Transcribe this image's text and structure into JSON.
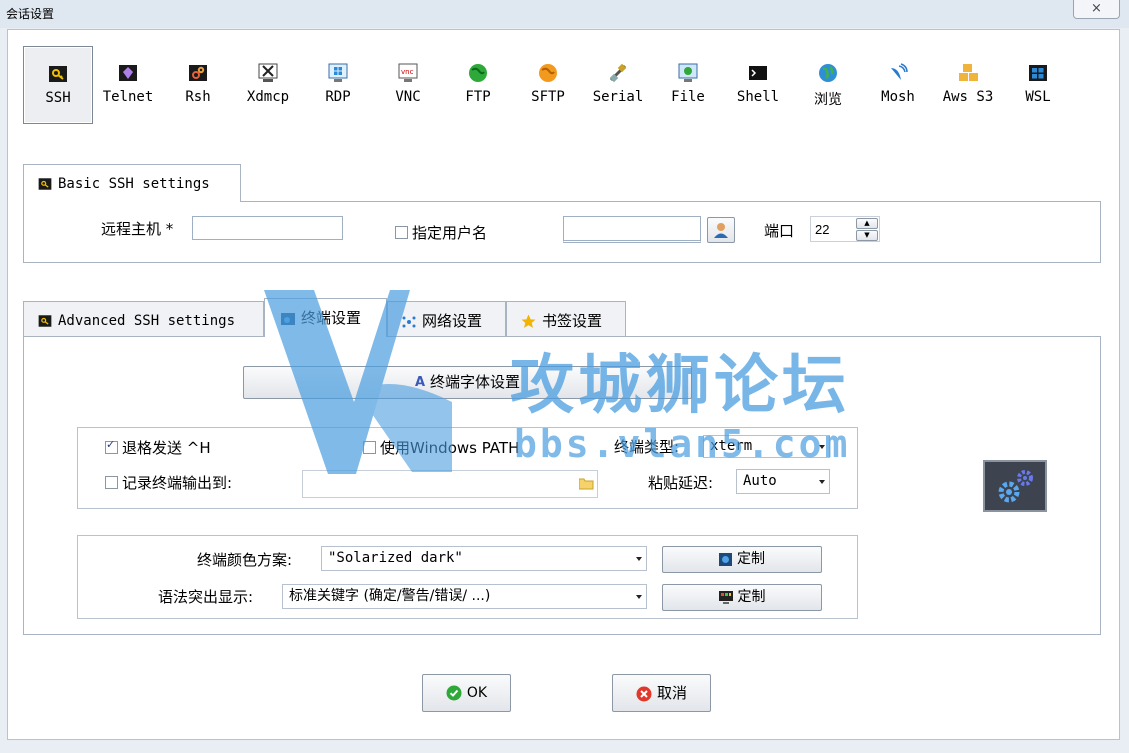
{
  "window": {
    "title": "会话设置",
    "close_glyph": "×"
  },
  "session_types": [
    {
      "label": "SSH",
      "icon": "key-icon",
      "selected": true
    },
    {
      "label": "Telnet",
      "icon": "purple-gem-icon"
    },
    {
      "label": "Rsh",
      "icon": "gears-icon"
    },
    {
      "label": "Xdmcp",
      "icon": "x-server-icon"
    },
    {
      "label": "RDP",
      "icon": "monitor-windows-icon"
    },
    {
      "label": "VNC",
      "icon": "vnc-icon"
    },
    {
      "label": "FTP",
      "icon": "globe-green-icon"
    },
    {
      "label": "SFTP",
      "icon": "globe-orange-icon"
    },
    {
      "label": "Serial",
      "icon": "satellite-icon"
    },
    {
      "label": "File",
      "icon": "monitor-file-icon"
    },
    {
      "label": "Shell",
      "icon": "terminal-icon"
    },
    {
      "label": "浏览",
      "icon": "globe-earth-icon"
    },
    {
      "label": "Mosh",
      "icon": "antenna-icon"
    },
    {
      "label": "Aws S3",
      "icon": "cubes-icon"
    },
    {
      "label": "WSL",
      "icon": "windows-logo-icon"
    }
  ],
  "basic": {
    "tab_label": "Basic SSH settings",
    "remote_host_label": "远程主机 *",
    "remote_host_value": "",
    "specify_user_label": "指定用户名",
    "specify_user_checked": false,
    "username_value": "",
    "port_label": "端口",
    "port_value": "22"
  },
  "advanced_tabs": [
    {
      "label": "Advanced SSH settings",
      "icon": "key-icon",
      "active": false
    },
    {
      "label": "终端设置",
      "icon": "terminal-settings-icon",
      "active": true
    },
    {
      "label": "网络设置",
      "icon": "network-icon",
      "active": false
    },
    {
      "label": "书签设置",
      "icon": "star-icon",
      "active": false
    }
  ],
  "terminal": {
    "font_button": "终端字体设置",
    "backspace_label": "退格发送 ^H",
    "backspace_checked": true,
    "use_windows_path_label": "使用Windows PATH",
    "use_windows_path_checked": false,
    "term_type_label": "终端类型:",
    "term_type_value": "xterm",
    "log_output_label": "记录终端输出到:",
    "log_output_checked": false,
    "log_path_value": "",
    "paste_delay_label": "粘贴延迟:",
    "paste_delay_value": "Auto",
    "color_scheme_label": "终端颜色方案:",
    "color_scheme_value": "\"Solarized dark\"",
    "color_customize": "定制",
    "syntax_label": "语法突出显示:",
    "syntax_value": "标准关键字 (确定/警告/错误/ ...)",
    "syntax_customize": "定制"
  },
  "footer": {
    "ok": "OK",
    "cancel": "取消"
  },
  "watermark": {
    "title": "攻城狮论坛",
    "url": "bbs.vlan5.com"
  },
  "colors": {
    "accent": "#3a7bd5",
    "watermark": "#4a9ee0"
  }
}
